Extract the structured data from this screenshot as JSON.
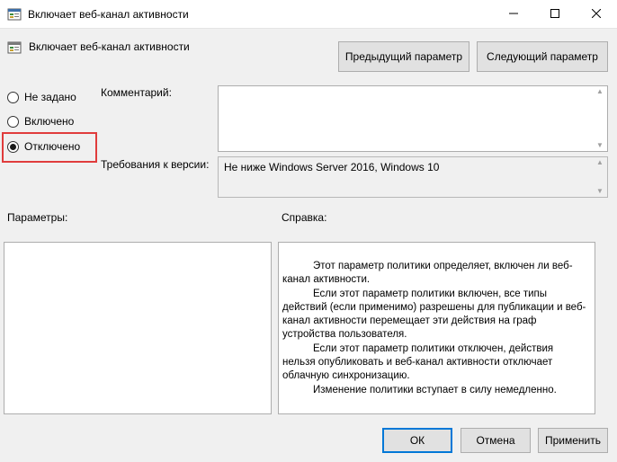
{
  "window": {
    "title": "Включает веб-канал активности",
    "icon": "policy-icon",
    "controls": [
      "minimize-icon",
      "maximize-icon",
      "close-icon"
    ]
  },
  "policy": {
    "name": "Включает веб-канал активности"
  },
  "nav": {
    "prev_label": "Предыдущий параметр",
    "next_label": "Следующий параметр"
  },
  "state": {
    "options": [
      {
        "label": "Не задано",
        "checked": false
      },
      {
        "label": "Включено",
        "checked": false
      },
      {
        "label": "Отключено",
        "checked": true
      }
    ],
    "highlight_color": "#e03c3c"
  },
  "comment": {
    "label": "Комментарий:",
    "value": ""
  },
  "requirements": {
    "label": "Требования к версии:",
    "value": "Не ниже Windows Server 2016, Windows 10"
  },
  "params": {
    "label": "Параметры:"
  },
  "help": {
    "label": "Справка:",
    "paragraphs": [
      "Этот параметр политики определяет, включен ли веб-канал активности.",
      "Если этот параметр политики включен, все типы действий (если применимо) разрешены для публикации и веб-канал активности перемещает эти действия на граф устройства пользователя.",
      "Если этот параметр политики отключен, действия нельзя опубликовать и веб-канал активности отключает облачную синхронизацию.",
      "Изменение политики вступает в силу немедленно."
    ]
  },
  "footer": {
    "ok_label": "ОК",
    "cancel_label": "Отмена",
    "apply_label": "Применить",
    "accent": "#0078d7"
  }
}
